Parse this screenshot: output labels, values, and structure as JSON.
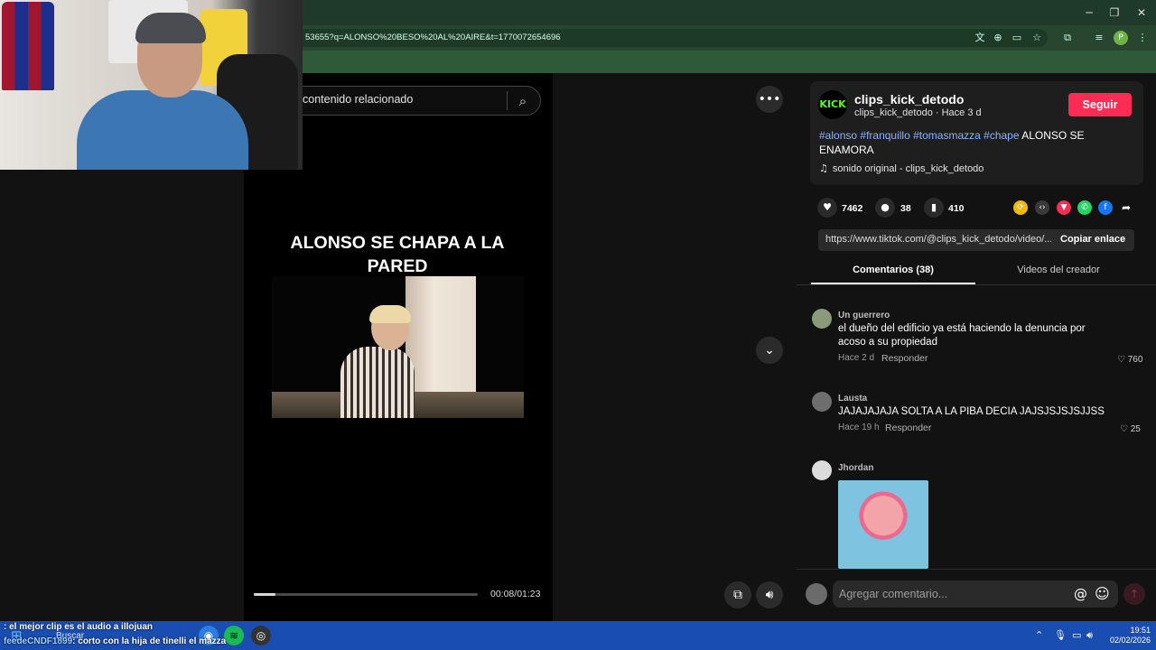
{
  "browser": {
    "url": "53655?q=ALONSO%20BESO%20AL%20AIRE&t=1770072654696",
    "window_controls": [
      "minimize-icon",
      "restore-icon",
      "close-icon"
    ],
    "profile_initial": "P"
  },
  "search": {
    "text": "contenido relacionado"
  },
  "video": {
    "title": "ALONSO SE CHAPA A LA PARED",
    "time": "00:08/01:23",
    "progress_fraction": 0.096
  },
  "author": {
    "avatar_text": "KICK",
    "username": "clips_kick_detodo",
    "subline": "clips_kick_detodo · Hace 3 d",
    "follow_label": "Seguir"
  },
  "caption": {
    "tags": [
      "#alonso",
      "#franquillo",
      "#tomasmazza",
      "#chape"
    ],
    "text": "ALONSO SE ENAMORA"
  },
  "music": {
    "label": "sonido original - clips_kick_detodo"
  },
  "stats": {
    "likes": "7462",
    "comments": "38",
    "saves": "410"
  },
  "share_icons": [
    "repost-icon",
    "embed-icon",
    "send-icon",
    "whatsapp-icon",
    "facebook-icon",
    "share-arrow-icon"
  ],
  "link": {
    "url": "https://www.tiktok.com/@clips_kick_detodo/video/...",
    "copy_label": "Copiar enlace"
  },
  "tabs": {
    "comments": "Comentarios (38)",
    "videos": "Videos del creador"
  },
  "comments": [
    {
      "name": "Un guerrero",
      "text": "el dueño del edificio ya está haciendo la denuncia por acoso a su propiedad",
      "time": "Hace 2 d",
      "reply": "Responder",
      "likes": "760"
    },
    {
      "name": "Lausta",
      "text": "JAJAJAJAJA SOLTA A LA PIBA DECIA JAJSJSJSJSJJSS",
      "time": "Hace 19 h",
      "reply": "Responder",
      "likes": "25"
    },
    {
      "name": "Jhordan"
    }
  ],
  "comment_box": {
    "placeholder": "Agregar comentario..."
  },
  "taskbar": {
    "search_label": "Buscar",
    "time": "19:51",
    "date": "02/02/2026"
  },
  "stream_chat": [
    {
      "user": "",
      "text": ": el mejor clip es el audio a illojuan"
    },
    {
      "user": "feedeCNDF1899",
      "text": ": corto con la hija de tinelli el mazza"
    }
  ],
  "colors": {
    "follow": "#fe2c55",
    "tag": "#8ab4ff",
    "taskbar": "#1a4db0"
  }
}
